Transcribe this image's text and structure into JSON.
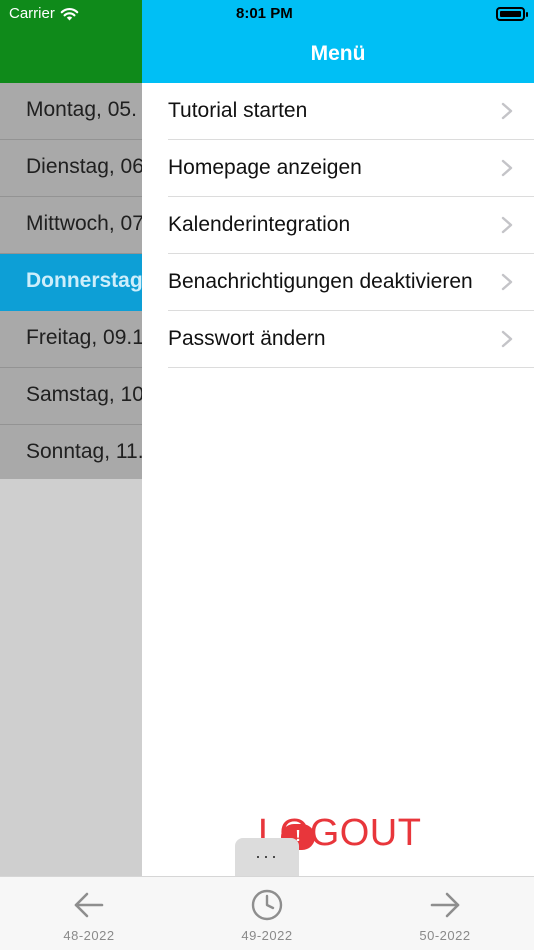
{
  "status_bar": {
    "carrier": "Carrier",
    "time": "8:01 PM",
    "icons": [
      "wifi-icon",
      "battery-icon"
    ]
  },
  "background_list": {
    "days": [
      {
        "label": "Montag, 05.",
        "selected": false
      },
      {
        "label": "Dienstag, 06",
        "selected": false
      },
      {
        "label": "Mittwoch, 07",
        "selected": false
      },
      {
        "label": "Donnerstag",
        "selected": true
      },
      {
        "label": "Freitag, 09.1",
        "selected": false
      },
      {
        "label": "Samstag, 10",
        "selected": false
      },
      {
        "label": "Sonntag, 11.",
        "selected": false
      }
    ]
  },
  "menu": {
    "title": "Menü",
    "items": [
      {
        "label": "Tutorial starten",
        "icon": "chevron-right-icon"
      },
      {
        "label": "Homepage anzeigen",
        "icon": "chevron-right-icon"
      },
      {
        "label": "Kalenderintegration",
        "icon": "chevron-right-icon"
      },
      {
        "label": "Benachrichtigungen deaktivieren",
        "icon": "chevron-right-icon"
      },
      {
        "label": "Passwort ändern",
        "icon": "chevron-right-icon"
      }
    ],
    "logout_label": "LOGOUT",
    "error_badge": "!",
    "more_label": "···"
  },
  "toolbar": {
    "prev": {
      "label": "48-2022",
      "icon": "arrow-left-icon"
    },
    "current": {
      "label": "49-2022",
      "icon": "clock-icon"
    },
    "next": {
      "label": "50-2022",
      "icon": "arrow-right-icon"
    }
  },
  "colors": {
    "menu_header": "#00bff5",
    "left_header": "#0f8a1a",
    "selected_row": "#0d9fd6",
    "logout": "#e8363b"
  }
}
